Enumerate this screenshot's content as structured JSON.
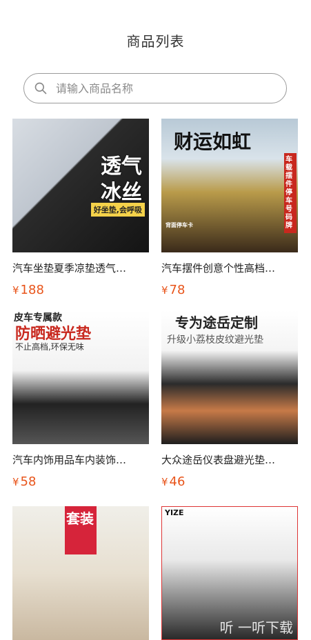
{
  "header": {
    "title": "商品列表"
  },
  "search": {
    "placeholder": "请输入商品名称"
  },
  "products": [
    {
      "name": "汽车坐垫夏季凉垫透气…",
      "price_symbol": "¥",
      "price": "188",
      "image_text": {
        "line1": "透气",
        "line2": "冰丝",
        "line3": "好坐垫,会呼吸"
      }
    },
    {
      "name": "汽车摆件创意个性高档…",
      "price_symbol": "¥",
      "price": "78",
      "image_text": {
        "line1": "财运如虹",
        "line2": "车载摆件停车号码牌",
        "line3": "背面停车卡"
      }
    },
    {
      "name": "汽车内饰用品车内装饰…",
      "price_symbol": "¥",
      "price": "58",
      "image_text": {
        "line1": "皮车专属款",
        "line2": "防晒避光垫",
        "line3": "不止高档,环保无味"
      }
    },
    {
      "name": "大众途岳仪表盘避光垫…",
      "price_symbol": "¥",
      "price": "46",
      "image_text": {
        "line1": "专为途岳定制",
        "line2": "升级小荔枝皮纹避光垫"
      }
    },
    {
      "name": "",
      "price_symbol": "",
      "price": "",
      "image_text": {
        "line1": "套装"
      }
    },
    {
      "name": "",
      "price_symbol": "",
      "price": "",
      "image_text": {
        "line1": "YIZE"
      }
    }
  ],
  "watermark": "听 一听下载",
  "colors": {
    "price": "#e8541a",
    "title": "#333333",
    "search_border": "#9a9a9a"
  }
}
